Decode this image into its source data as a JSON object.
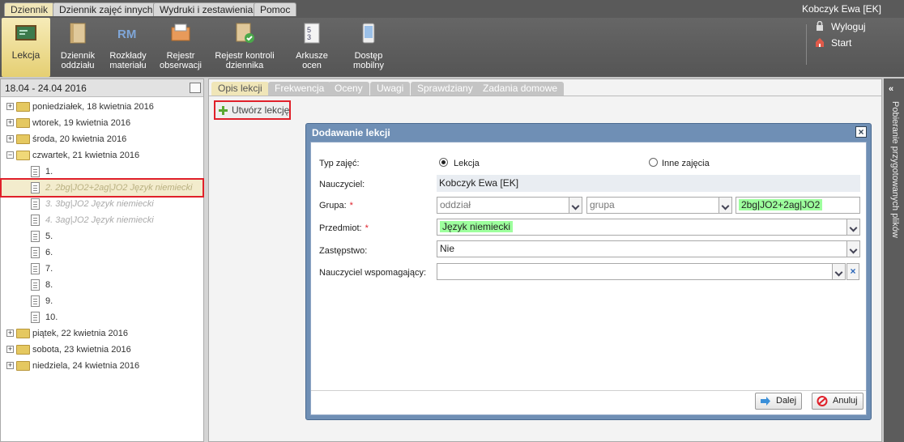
{
  "menu": {
    "tabs": [
      "Dziennik",
      "Dziennik zajęć innych",
      "Wydruki i zestawienia",
      "Pomoc"
    ],
    "user": "Kobczyk Ewa [EK]"
  },
  "toolbar": {
    "items": [
      "Lekcja",
      "Dziennik oddziału",
      "Rozkłady materiału",
      "Rejestr obserwacji",
      "Rejestr kontroli dziennika",
      "Arkusze ocen",
      "Dostęp mobilny"
    ],
    "logout": "Wyloguj",
    "start": "Start",
    "colors": {
      "active": "#f0e6b8",
      "bar": "#5a5a5a"
    }
  },
  "sidebar": {
    "week": "18.04 - 24.04 2016",
    "days": {
      "mon": "poniedziałek, 18 kwietnia 2016",
      "tue": "wtorek, 19 kwietnia 2016",
      "wed": "środa, 20 kwietnia 2016",
      "thu": "czwartek, 21 kwietnia 2016",
      "fri": "piątek, 22 kwietnia 2016",
      "sat": "sobota, 23 kwietnia 2016",
      "sun": "niedziela, 24 kwietnia 2016"
    },
    "lessons": [
      "1.",
      "2. 2bg|JO2+2ag|JO2 Język niemiecki",
      "3. 3bg|JO2 Język niemiecki",
      "4. 3ag|JO2 Język niemiecki",
      "5.",
      "6.",
      "7.",
      "8.",
      "9.",
      "10."
    ]
  },
  "tabs": [
    "Opis lekcji",
    "Frekwencja",
    "Oceny",
    "Uwagi",
    "Sprawdziany",
    "Zadania domowe"
  ],
  "create_button": "Utwórz lekcję",
  "right_panel": "Pobieranie przygotowanych plików",
  "dialog": {
    "title": "Dodawanie lekcji",
    "fields": {
      "type_label": "Typ zajęć:",
      "type_opt1": "Lekcja",
      "type_opt2": "Inne zajęcia",
      "teacher_label": "Nauczyciel:",
      "teacher_value": "Kobczyk Ewa [EK]",
      "group_label": "Grupa:",
      "class_placeholder": "oddział",
      "group_placeholder": "grupa",
      "group_value": "2bg|JO2+2ag|JO2",
      "subject_label": "Przedmiot:",
      "subject_value": "Język niemiecki",
      "substitution_label": "Zastępstwo:",
      "substitution_value": "Nie",
      "assistant_label": "Nauczyciel wspomagający:",
      "required_mark": "*"
    },
    "next": "Dalej",
    "cancel": "Anuluj",
    "colors": {
      "title_bar": "#6f8fb5",
      "highlight": "#9dff9d",
      "required": "#e0202a"
    }
  }
}
